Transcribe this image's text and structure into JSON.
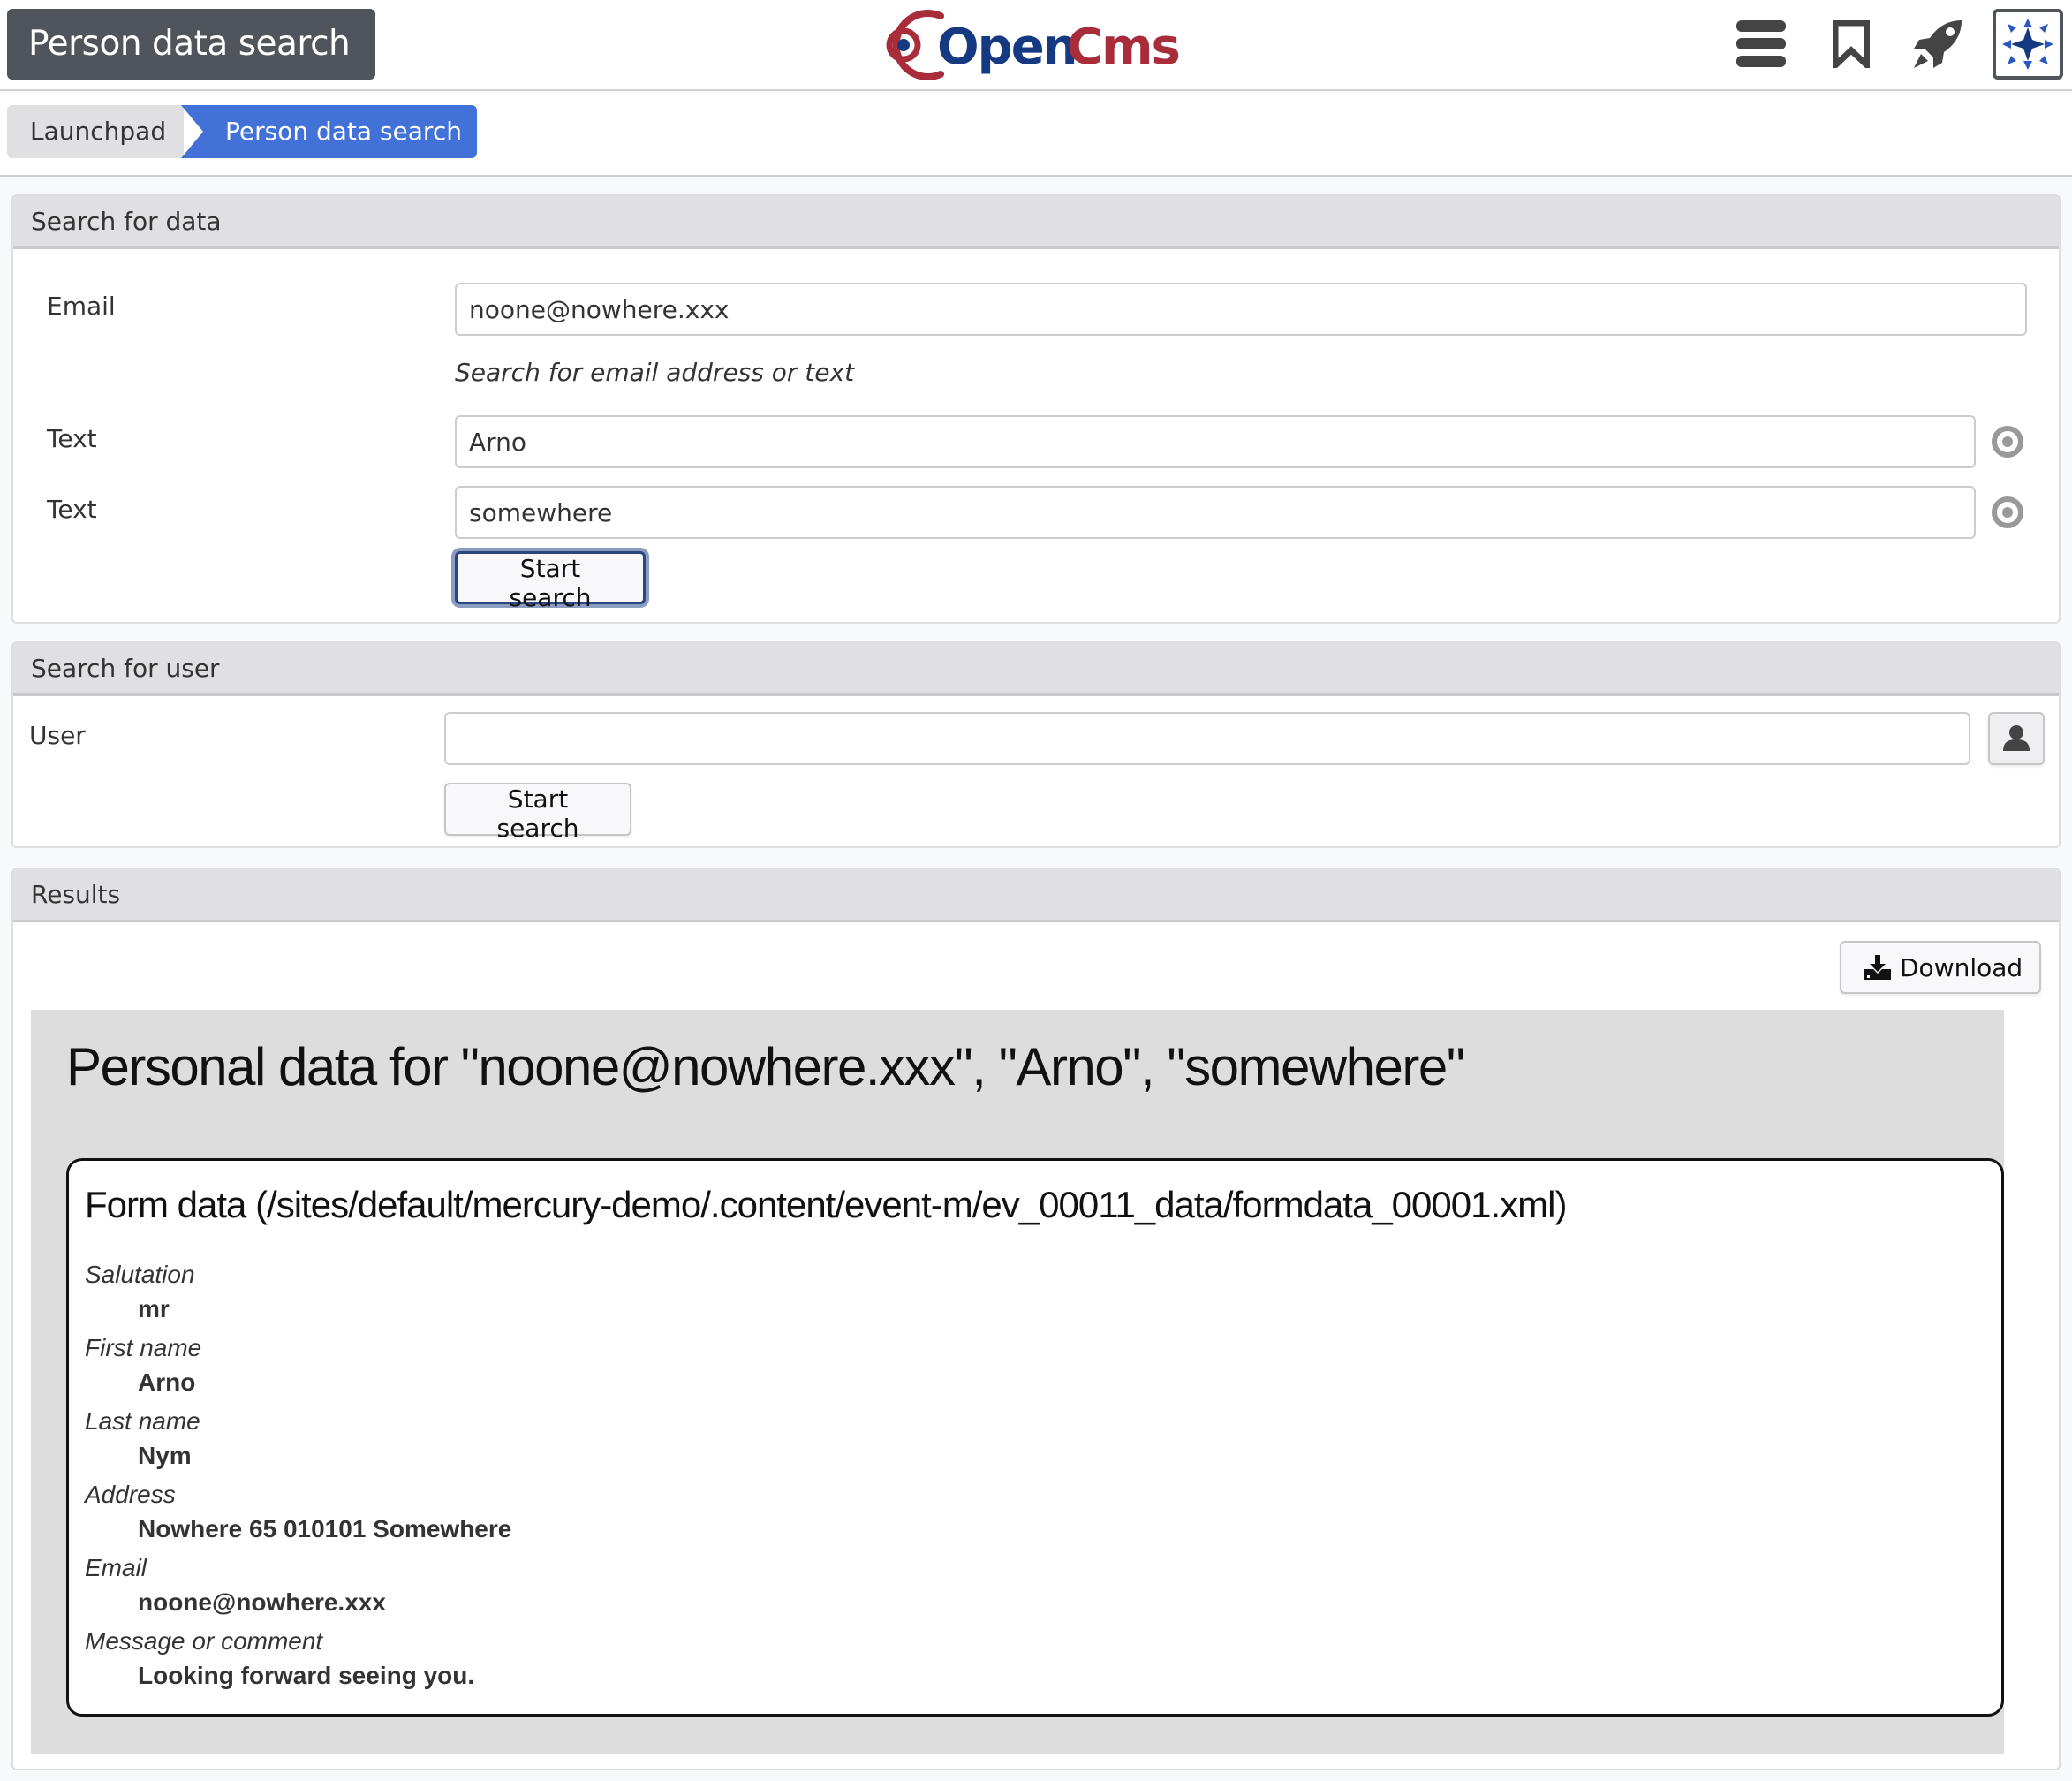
{
  "header": {
    "app_title": "Person data search",
    "logo_text": "OpenCms",
    "logo_colors": {
      "red": "#a82c3a",
      "blue": "#163a82"
    },
    "icons": [
      "menu-icon",
      "bookmark-icon",
      "rocket-icon",
      "user-avatar"
    ]
  },
  "breadcrumb": {
    "items": [
      {
        "label": "Launchpad"
      },
      {
        "label": "Person data search"
      }
    ],
    "active_color": "#4271d7"
  },
  "search_data_panel": {
    "title": "Search for data",
    "email_label": "Email",
    "email_value": "noone@nowhere.xxx",
    "hint": "Search for email address or text",
    "text_fields": [
      {
        "label": "Text",
        "value": "Arno"
      },
      {
        "label": "Text",
        "value": "somewhere"
      }
    ],
    "button_label": "Start search"
  },
  "search_user_panel": {
    "title": "Search for user",
    "user_label": "User",
    "user_value": "",
    "button_label": "Start search"
  },
  "results_panel": {
    "title": "Results",
    "download_label": "Download",
    "report_title": "Personal data for \"noone@nowhere.xxx\", \"Arno\", \"somewhere\"",
    "form_title": "Form data (/sites/default/mercury-demo/.content/event-m/ev_00011_data/formdata_00001.xml)",
    "fields": [
      {
        "label": "Salutation",
        "value": "mr"
      },
      {
        "label": "First name",
        "value": "Arno"
      },
      {
        "label": "Last name",
        "value": "Nym"
      },
      {
        "label": "Address",
        "value": "Nowhere 65 010101 Somewhere"
      },
      {
        "label": "Email",
        "value": "noone@nowhere.xxx"
      },
      {
        "label": "Message or comment",
        "value": "Looking forward seeing you."
      }
    ]
  }
}
